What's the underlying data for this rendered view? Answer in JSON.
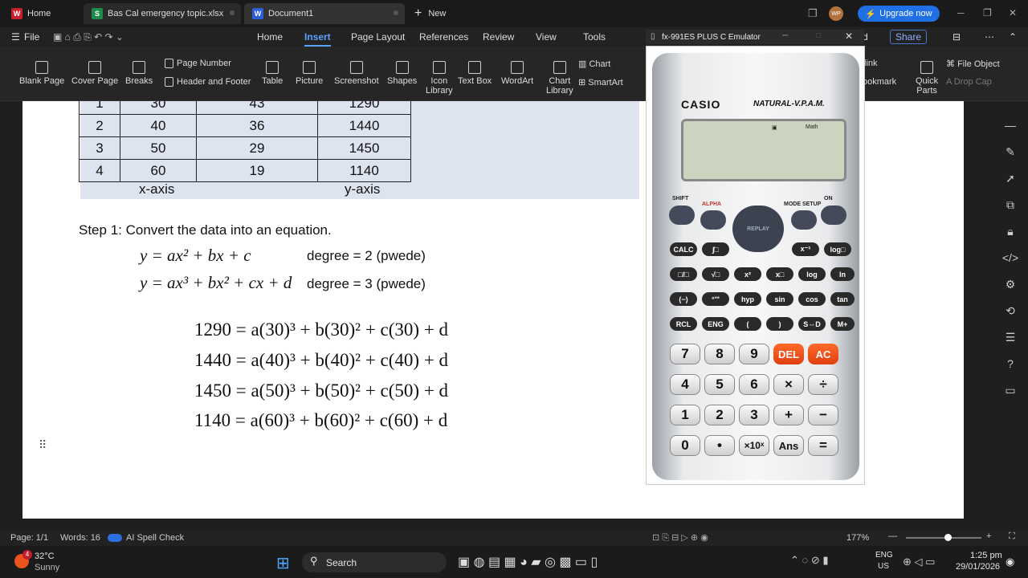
{
  "tabs": {
    "home": "Home",
    "xlsx": "Bas Cal emergency topic.xlsx",
    "doc": "Document1",
    "new": "New"
  },
  "topbar": {
    "avatar": "WP",
    "upgrade": "Upgrade now"
  },
  "menu": {
    "file": "File",
    "items": [
      "Home",
      "Insert",
      "Page Layout",
      "References",
      "Review",
      "View",
      "Tools"
    ],
    "right_tail": "d",
    "share": "Share"
  },
  "ribbon": {
    "buttons": [
      "Blank Page",
      "Cover Page",
      "Breaks",
      "Page Number",
      "Header and",
      "Footer",
      "Table",
      "Picture",
      "Screenshot",
      "Shapes",
      "Icon",
      "Library",
      "Text Box",
      "WordArt",
      "Chart",
      "Library",
      "Chart",
      "SmartArt"
    ],
    "right": {
      "link": "link",
      "bookmark": "ookmark",
      "quick": "Quick",
      "parts": "Parts",
      "file_object": "File Object",
      "drop_cap": "Drop Cap"
    }
  },
  "document": {
    "table": {
      "partial_row": [
        "1",
        "30",
        "43",
        "1290"
      ],
      "rows": [
        [
          "2",
          "40",
          "36",
          "1440"
        ],
        [
          "3",
          "50",
          "29",
          "1450"
        ],
        [
          "4",
          "60",
          "19",
          "1140"
        ]
      ]
    },
    "xaxis": "x-axis",
    "yaxis": "y-axis",
    "step": "Step 1: Convert the data into an equation.",
    "eq1": "y = ax² + bx + c",
    "eq1_degree": "degree = 2 (pwede)",
    "eq2": "y = ax³ + bx² + cx + d",
    "eq2_degree": "degree = 3 (pwede)",
    "system": [
      "1290 = a(30)³ + b(30)² + c(30) + d",
      "1440 = a(40)³ + b(40)² + c(40) + d",
      "1450 = a(50)³ + b(50)² + c(50) + d",
      "1140 = a(60)³ + b(60)² + c(60) + d"
    ]
  },
  "calculator": {
    "title": "fx-991ES PLUS C Emulator",
    "brand": "CASIO",
    "model": "NATURAL-V.P.A.M.",
    "screen_indicator": "Math",
    "top_labels": [
      "SHIFT",
      "ALPHA",
      "MODE SETUP",
      "ON",
      "REPLAY"
    ],
    "fn_row1": [
      "CALC",
      "∫□",
      "x⁻¹",
      "log□"
    ],
    "fn_row2": [
      "□/□",
      "√□",
      "x²",
      "x□",
      "log",
      "ln"
    ],
    "fn_row3": [
      "(−)",
      "°'\"",
      "hyp",
      "sin",
      "cos",
      "tan"
    ],
    "fn_row4": [
      "RCL",
      "ENG",
      "(",
      ")",
      "S⇔D",
      "M+"
    ],
    "num_rows": [
      [
        "7",
        "8",
        "9",
        "DEL",
        "AC"
      ],
      [
        "4",
        "5",
        "6",
        "×",
        "÷"
      ],
      [
        "1",
        "2",
        "3",
        "+",
        "−"
      ],
      [
        "0",
        "•",
        "×10ˣ",
        "Ans",
        "="
      ]
    ]
  },
  "status": {
    "page": "Page: 1/1",
    "words": "Words: 16",
    "spell": "AI Spell Check",
    "zoom": "177%"
  },
  "taskbar": {
    "temp": "32°C",
    "weather": "Sunny",
    "search": "Search",
    "lang1": "ENG",
    "lang2": "US",
    "time": "1:25 pm",
    "date": "29/01/2026",
    "badge": "4"
  },
  "colors": {
    "accent": "#1f6fe5",
    "orange": "#e8541c"
  }
}
